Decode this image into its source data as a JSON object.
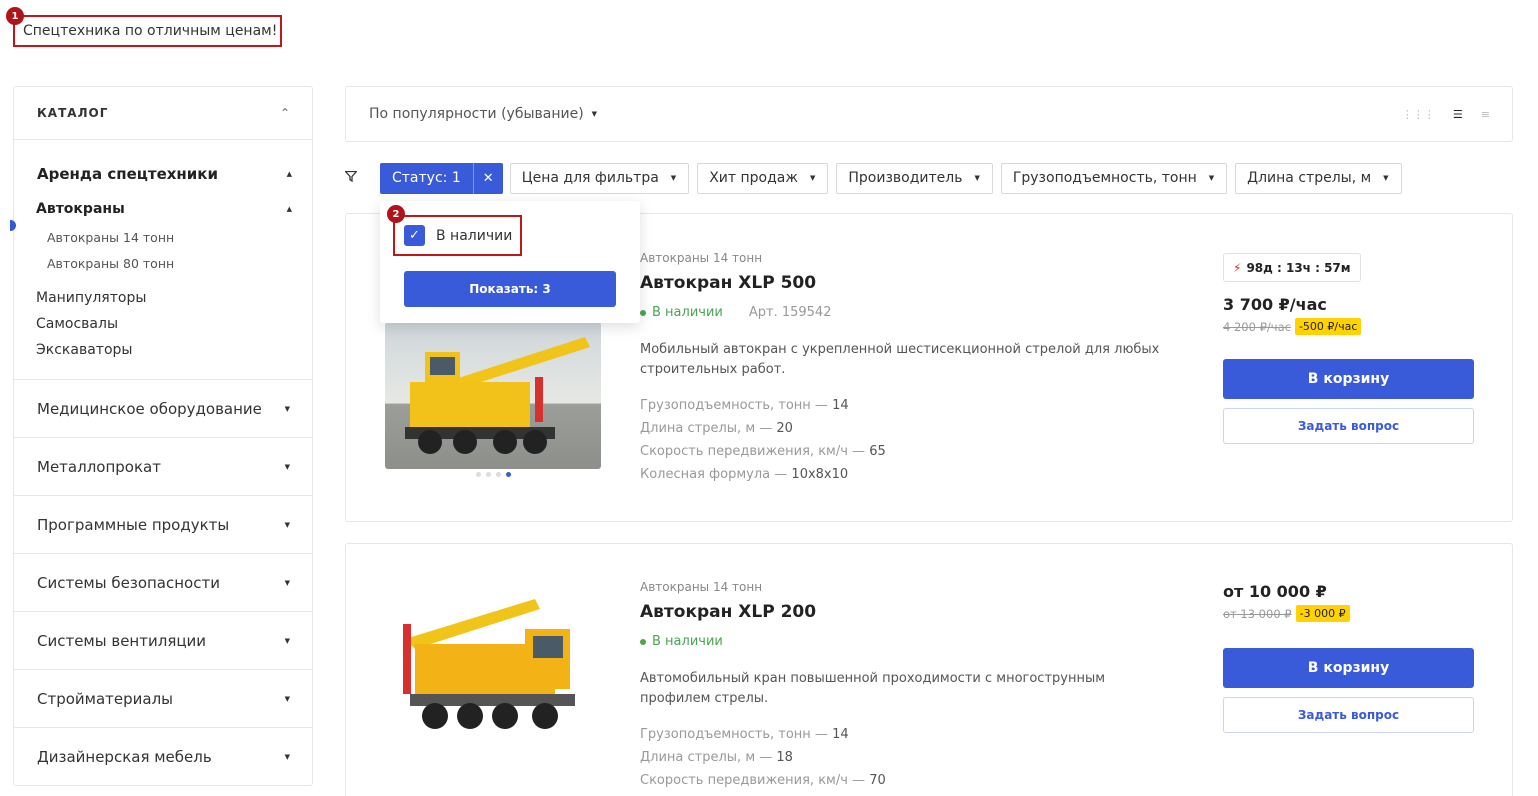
{
  "promo": {
    "text": "Спецтехника по отличным ценам!",
    "badge": "1"
  },
  "sidebar": {
    "title": "КАТАЛОГ",
    "open_section": "Аренда спецтехники",
    "open_sub": "Автокраны",
    "sub_items": [
      "Автокраны 14 тонн",
      "Автокраны 80 тонн"
    ],
    "siblings": [
      "Манипуляторы",
      "Самосвалы",
      "Экскаваторы"
    ],
    "sections": [
      "Медицинское оборудование",
      "Металлопрокат",
      "Программные продукты",
      "Системы безопасности",
      "Системы вентиляции",
      "Стройматериалы",
      "Дизайнерская мебель"
    ]
  },
  "sort": {
    "label": "По популярности (убывание)"
  },
  "filters": {
    "active": "Статус: 1",
    "chips": [
      "Цена для фильтра",
      "Хит продаж",
      "Производитель",
      "Грузоподъемность, тонн",
      "Длина стрелы, м"
    ]
  },
  "dropdown": {
    "option": "В наличии",
    "button": "Показать: 3",
    "badge": "2"
  },
  "products": [
    {
      "category": "Автокраны 14 тонн",
      "title": "Автокран XLP 500",
      "status": "В наличии",
      "article": "Арт. 159542",
      "description": "Мобильный автокран с укрепленной шестисекционной стрелой для любых строительных работ.",
      "props": [
        {
          "k": "Грузоподъемность, тонн — ",
          "v": "14"
        },
        {
          "k": "Длина стрелы, м — ",
          "v": "20"
        },
        {
          "k": "Скорость передвижения, км/ч — ",
          "v": "65"
        },
        {
          "k": "Колесная формула — ",
          "v": "10x8x10"
        }
      ],
      "timer": "98д : 13ч : 57м",
      "price": "3 700 ₽/час",
      "old_price": "4 200 ₽/час",
      "discount": "-500 ₽/час",
      "cart": "В корзину",
      "ask": "Задать вопрос"
    },
    {
      "category": "Автокраны 14 тонн",
      "title": "Автокран XLP 200",
      "status": "В наличии",
      "description": "Автомобильный кран повышенной проходимости с многострунным профилем стрелы.",
      "props": [
        {
          "k": "Грузоподъемность, тонн — ",
          "v": "14"
        },
        {
          "k": "Длина стрелы, м — ",
          "v": "18"
        },
        {
          "k": "Скорость передвижения, км/ч — ",
          "v": "70"
        }
      ],
      "price": "от 10 000 ₽",
      "old_price": "от 13 000 ₽",
      "discount": "-3 000 ₽",
      "cart": "В корзину",
      "ask": "Задать вопрос"
    }
  ],
  "colors": {
    "accent": "#3a5bd9",
    "in_stock": "#4aa54f",
    "discount": "#ffd200",
    "annotation": "#c0161c"
  },
  "icons": [
    "filter-icon",
    "grid-view-icon",
    "list-view-icon",
    "table-view-icon",
    "bolt-icon",
    "check-icon",
    "close-icon"
  ]
}
